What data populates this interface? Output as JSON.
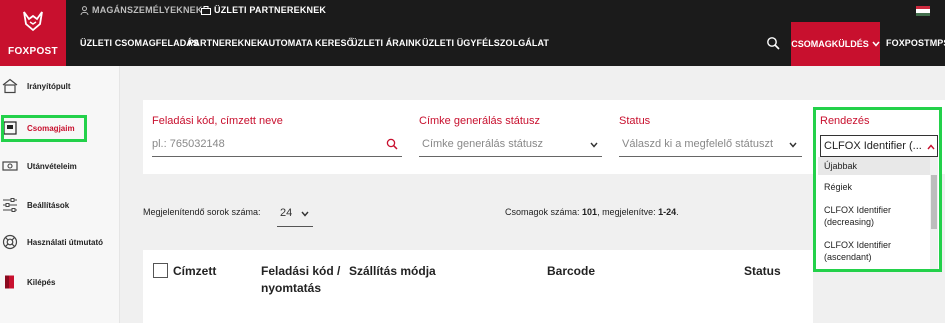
{
  "brand": {
    "name": "FOXPOST",
    "color": "#c8102e"
  },
  "topbar": {
    "links": [
      {
        "label": "MAGÁNSZEMÉLYEKNEK",
        "icon": "person-icon"
      },
      {
        "label": "ÜZLETI PARTNEREKNEK",
        "icon": "briefcase-icon"
      }
    ],
    "language_flag": "hungary-flag-icon"
  },
  "nav": {
    "items": [
      "ÜZLETI CSOMAGFELADÁS",
      "PARTNEREKNEK",
      "AUTOMATA KERESŐ",
      "ÜZLETI ÁRAINK",
      "ÜZLETI ÜGYFÉLSZOLGÁLAT"
    ],
    "primary_button": "CSOMAGKÜLDÉS",
    "truncated_item": "FOXPOSTMPS"
  },
  "sidebar": {
    "items": [
      {
        "label": "Irányítópult",
        "icon": "home-icon"
      },
      {
        "label": "Csomagjaim",
        "icon": "package-icon",
        "active": true
      },
      {
        "label": "Utánvételeim",
        "icon": "cash-icon"
      },
      {
        "label": "Beállítások",
        "icon": "sliders-icon"
      },
      {
        "label": "Használati útmutató",
        "icon": "lifebuoy-icon"
      },
      {
        "label": "Kilépés",
        "icon": "logout-icon"
      }
    ]
  },
  "filters": {
    "search": {
      "label": "Feladási kód, címzett neve",
      "placeholder": "pl.: 765032148"
    },
    "label_status": {
      "label": "Címke generálás státusz",
      "placeholder": "Címke generálás státusz"
    },
    "status": {
      "label": "Status",
      "placeholder": "Válaszd ki a megfelelő státuszt"
    },
    "sort": {
      "label": "Rendezés",
      "selected": "CLFOX Identifier (...",
      "options": [
        "Újabbak",
        "Régiek",
        "CLFOX Identifier (decreasing)",
        "CLFOX Identifier (ascendant)"
      ]
    }
  },
  "controls": {
    "rows_label": "Megjelenítendő sorok száma:",
    "rows_value": "24",
    "count_prefix": "Csomagok száma: ",
    "count_total": "101",
    "count_mid": ", megjelenítve: ",
    "count_range": "1-24",
    "count_suffix": "."
  },
  "table": {
    "headers": [
      "Címzett",
      "Feladási kód / nyomtatás",
      "Szállítás módja",
      "Barcode",
      "Status"
    ]
  }
}
